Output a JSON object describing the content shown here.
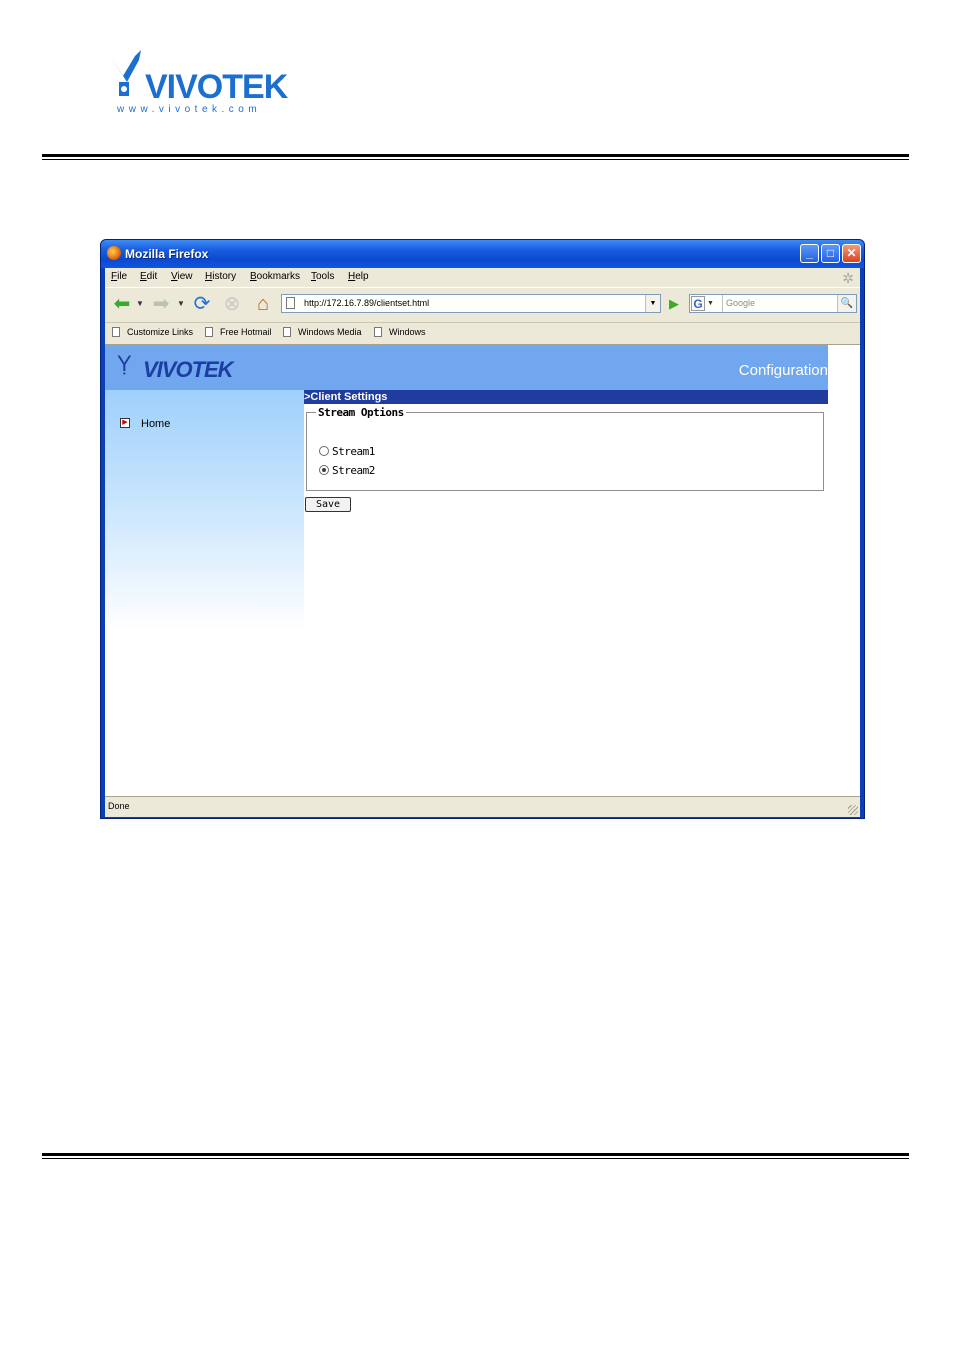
{
  "document": {
    "logo_text": "VIVOTEK",
    "logo_url": "www.vivotek.com"
  },
  "window": {
    "title": "Mozilla Firefox",
    "controls": {
      "minimize": "_",
      "maximize": "□",
      "close": "✕"
    }
  },
  "menu": [
    "File",
    "Edit",
    "View",
    "History",
    "Bookmarks",
    "Tools",
    "Help"
  ],
  "toolbar": {
    "url": "http://172.16.7.89/clientset.html",
    "search_placeholder": "Google",
    "search_engine_icon": "G"
  },
  "bookmarks": [
    "Customize Links",
    "Free Hotmail",
    "Windows Media",
    "Windows"
  ],
  "page": {
    "brand": "VIVOTEK",
    "header_title": "Configuration",
    "nav": {
      "home": "Home"
    },
    "section_title": ">Client Settings",
    "fieldset_legend": "Stream Options",
    "radios": [
      {
        "label": "Stream1",
        "checked": false
      },
      {
        "label": "Stream2",
        "checked": true
      }
    ],
    "save_label": "Save"
  },
  "status": {
    "text": "Done"
  },
  "colors": {
    "titlebar": "#0b4ad0",
    "banner": "#71a7ef",
    "section_bar": "#1f3c9e",
    "brand_blue": "#1d3da3"
  }
}
